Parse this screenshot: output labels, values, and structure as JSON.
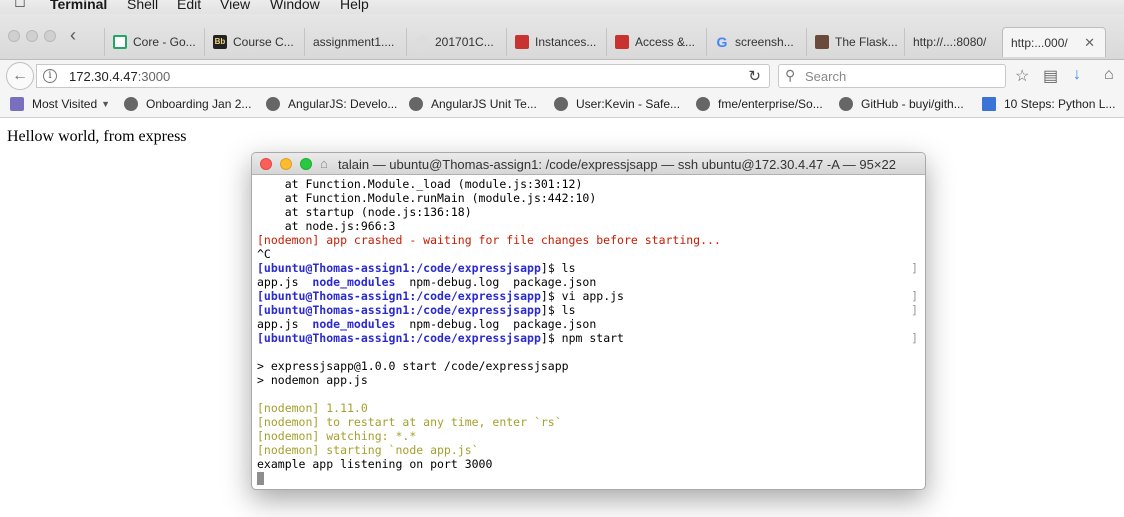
{
  "menubar": {
    "items": [
      "Terminal",
      "Shell",
      "Edit",
      "View",
      "Window",
      "Help"
    ]
  },
  "tabs": [
    {
      "label": "Core - Go...",
      "icon": "sheets-icon"
    },
    {
      "label": "Course C...",
      "icon": "blackboard-icon"
    },
    {
      "label": "assignment1....",
      "icon": ""
    },
    {
      "label": "201701C...",
      "icon": "gitlab-icon"
    },
    {
      "label": "Instances...",
      "icon": "aws-icon"
    },
    {
      "label": "Access &...",
      "icon": "aws-icon"
    },
    {
      "label": "screensh...",
      "icon": "google-icon"
    },
    {
      "label": "The Flask...",
      "icon": "avatar-icon"
    },
    {
      "label": "http://...:8080/",
      "icon": ""
    },
    {
      "label": "http:...000/",
      "icon": ""
    }
  ],
  "nav": {
    "url_host": "172.30.4.47",
    "url_port": ":3000",
    "search_placeholder": "Search"
  },
  "bookmarks": [
    {
      "label": "Most Visited",
      "icon": "folder-icon"
    },
    {
      "label": "Onboarding Jan 2...",
      "icon": "globe-icon"
    },
    {
      "label": "AngularJS: Develo...",
      "icon": "globe-icon"
    },
    {
      "label": "AngularJS Unit Te...",
      "icon": "globe-icon"
    },
    {
      "label": "User:Kevin - Safe...",
      "icon": "globe-icon"
    },
    {
      "label": "fme/enterprise/So...",
      "icon": "globe-icon"
    },
    {
      "label": "GitHub - buyi/gith...",
      "icon": "globe-icon"
    },
    {
      "label": "10 Steps: Python L...",
      "icon": "doc-icon"
    }
  ],
  "page": {
    "text": "Hellow world, from express"
  },
  "terminal": {
    "title": "talain — ubuntu@Thomas-assign1: /code/expressjsapp — ssh ubuntu@172.30.4.47 -A — 95×22",
    "lines": {
      "l1": "    at Function.Module._load (module.js:301:12)",
      "l2": "    at Function.Module.runMain (module.js:442:10)",
      "l3": "    at startup (node.js:136:18)",
      "l4": "    at node.js:966:3",
      "l5": "[nodemon] app crashed - waiting for file changes before starting...",
      "l6": "^C",
      "prompt_user": "[ubuntu@Thomas-assign1",
      "prompt_dir": ":/code/expressjsapp",
      "prompt_end": "]$ ",
      "cmd1": "ls",
      "ls_a": "app.js  ",
      "ls_nm": "node_modules",
      "ls_b": "  npm-debug.log  package.json",
      "cmd2": "vi app.js",
      "cmd3": "ls",
      "cmd4": "npm start",
      "npm1": "> expressjsapp@1.0.0 start /code/expressjsapp",
      "npm2": "> nodemon app.js",
      "nd1": "[nodemon] 1.11.0",
      "nd2": "[nodemon] to restart at any time, enter `rs`",
      "nd3": "[nodemon] watching: *.*",
      "nd4": "[nodemon] starting `node app.js`",
      "listen": "example app listening on port 3000"
    }
  }
}
